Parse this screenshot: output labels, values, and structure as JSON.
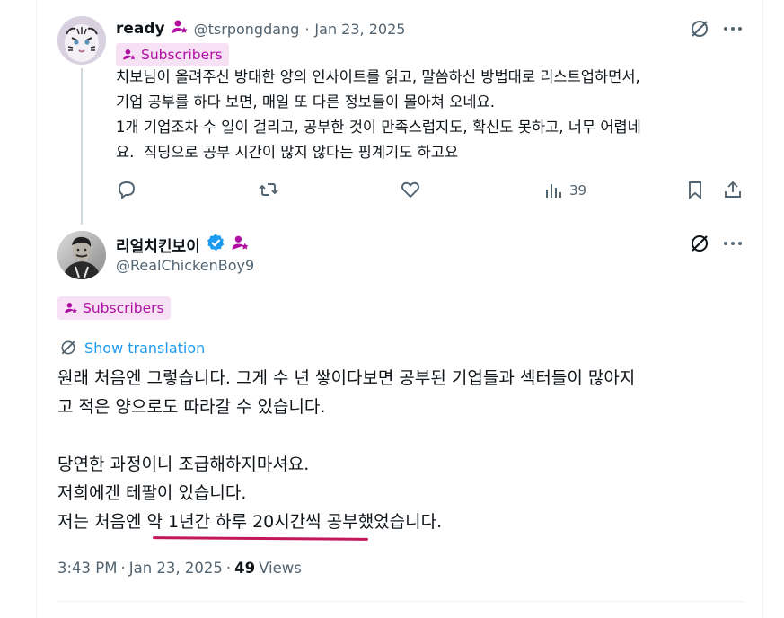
{
  "reply": {
    "author_name": "ready",
    "handle": "@tsrpongdang",
    "separator": "·",
    "date": "Jan 23, 2025",
    "badge_label": "Subscribers",
    "text": "치보님이 올려주신 방대한 양의 인사이트를 읽고, 말씀하신 방법대로 리스트업하면서,\n기업 공부를 하다 보면, 매일 또 다른 정보들이 몰아쳐 오네요.\n1개 기업조차 수 일이 걸리고, 공부한 것이 만족스럽지도, 확신도 못하고, 너무 어렵네\n요.  직딩으로 공부 시간이 많지 않다는 핑계기도 하고요",
    "views_count": "39",
    "avatar_icon": "white-tiger-avatar"
  },
  "main_post": {
    "author_name": "리얼치킨보이",
    "handle": "@RealChickenBoy9",
    "badge_label": "Subscribers",
    "show_translation": "Show translation",
    "text": "원래 처음엔 그렇습니다. 그게 수 년 쌓이다보면 공부된 기업들과 섹터들이 많아지\n고 적은 양으로도 따라갈 수 있습니다.\n\n당연한 과정이니 조급해하지마셔요.\n저희에겐 테팔이 있습니다.\n저는 처음엔 약 1년간 하루 20시간씩 공부했었습니다.",
    "time": "3:43 PM",
    "separator": "·",
    "date": "Jan 23, 2025",
    "separator2": "·",
    "views_count": "49",
    "views_label": "Views",
    "avatar_icon": "man-portrait-avatar"
  },
  "colors": {
    "accent_blue": "#1d9bf0",
    "subscriber_pink": "#b10fa4",
    "subscriber_bg": "#f7e1f5",
    "underline": "#c2185b",
    "muted": "#536471"
  }
}
